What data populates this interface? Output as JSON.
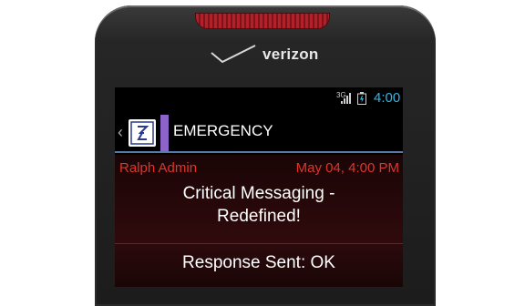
{
  "device": {
    "carrier_logo": "verizon",
    "colors": {
      "speaker": "#b0212a",
      "body": "#1c1c1c"
    }
  },
  "status_bar": {
    "network": "3G",
    "time": "4:00",
    "icons": [
      "signal-icon",
      "battery-icon"
    ],
    "time_color": "#33b5e5"
  },
  "header": {
    "title": "EMERGENCY",
    "accent_color": "#8e63c9",
    "icons": [
      "back-arrow-icon",
      "app-logo-icon"
    ]
  },
  "message": {
    "sender": "Ralph Admin",
    "date": "May 04, 4:00 PM",
    "body_line1": "Critical Messaging -",
    "body_line2": "Redefined!",
    "meta_color": "#e0342c"
  },
  "response": {
    "text": "Response Sent: OK"
  }
}
